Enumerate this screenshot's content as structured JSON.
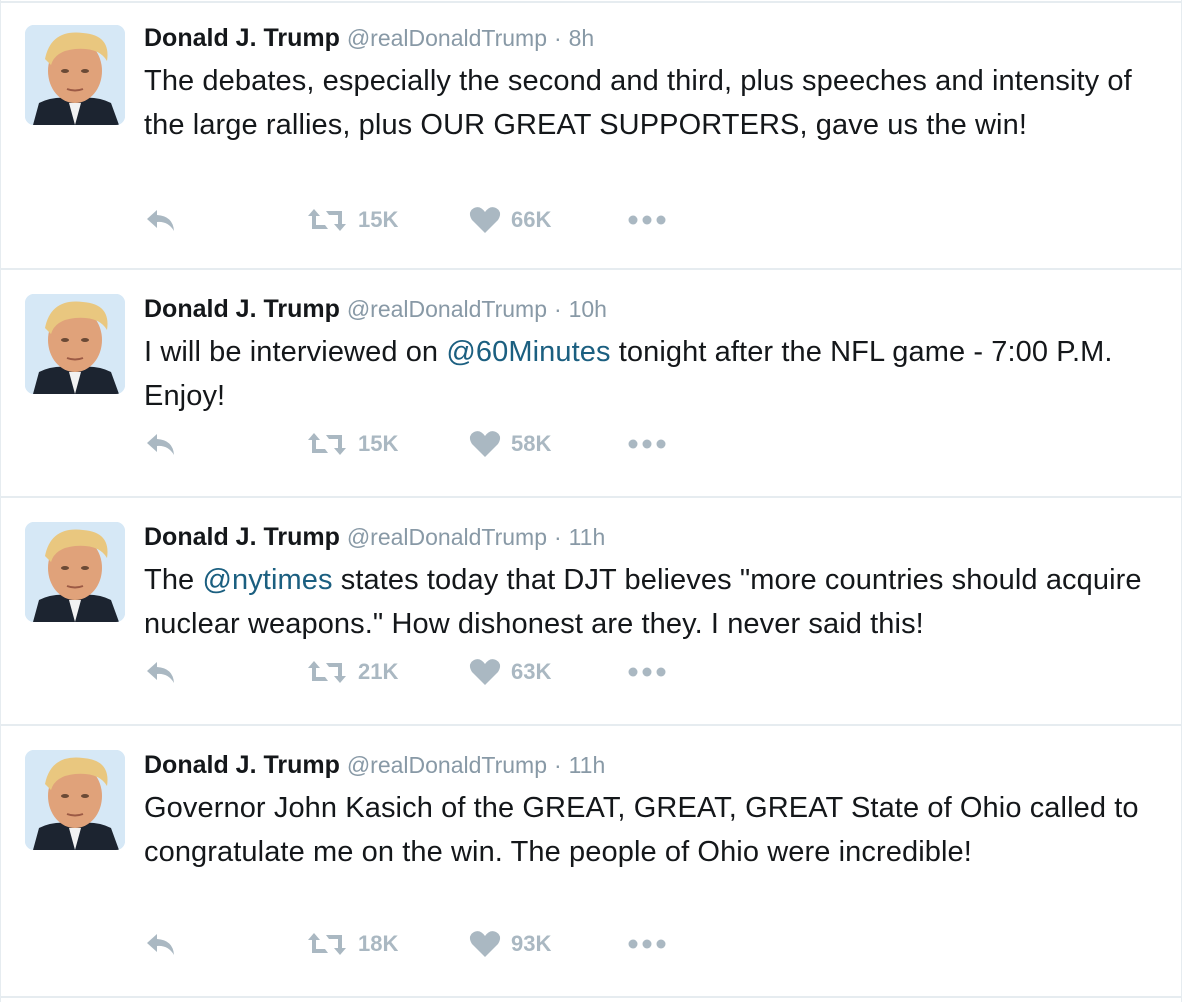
{
  "colors": {
    "name": "#14171a",
    "muted": "#8899a6",
    "icon": "#aab8c2",
    "mention": "#1b5f80",
    "divider": "#e6ecf0"
  },
  "tweets": [
    {
      "name": "Donald J. Trump",
      "handle": "@realDonaldTrump",
      "dot": "·",
      "time": "8h",
      "text_parts": [
        "The debates, especially the second and third, plus speeches and intensity of the large rallies, plus OUR GREAT SUPPORTERS, gave us the win!"
      ],
      "retweets": "15K",
      "likes": "66K",
      "icons": [
        "reply-icon",
        "retweet-icon",
        "heart-icon",
        "more-icon"
      ]
    },
    {
      "name": "Donald J. Trump",
      "handle": "@realDonaldTrump",
      "dot": "·",
      "time": "10h",
      "text_before": "I will be interviewed on ",
      "mention": "@60Minutes",
      "text_after": " tonight after the NFL game - 7:00 P.M. Enjoy!",
      "retweets": "15K",
      "likes": "58K"
    },
    {
      "name": "Donald J. Trump",
      "handle": "@realDonaldTrump",
      "dot": "·",
      "time": "11h",
      "text_before": "The ",
      "mention": "@nytimes",
      "text_after": " states today that DJT believes \"more countries should acquire nuclear weapons.\" How dishonest are they. I never said this!",
      "retweets": "21K",
      "likes": "63K"
    },
    {
      "name": "Donald J. Trump",
      "handle": "@realDonaldTrump",
      "dot": "·",
      "time": "11h",
      "text": "Governor John Kasich of the GREAT, GREAT, GREAT State of Ohio called to congratulate me on the win. The people of Ohio were incredible!",
      "retweets": "18K",
      "likes": "93K"
    }
  ]
}
